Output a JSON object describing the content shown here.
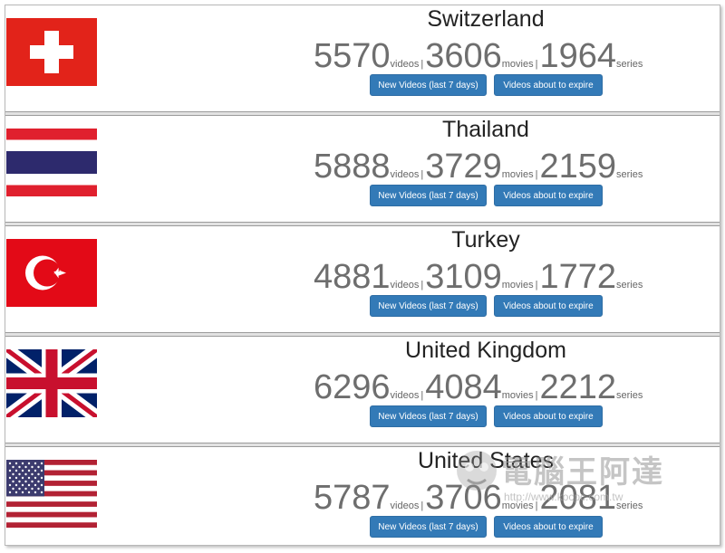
{
  "buttons": {
    "new_videos": "New Videos (last 7 days)",
    "about_to_expire": "Videos about to expire"
  },
  "units": {
    "videos": "videos",
    "movies": "movies",
    "series": "series",
    "separator": "|"
  },
  "countries": [
    {
      "name": "Switzerland",
      "flag_icon": "flag-switzerland-icon",
      "videos": "5570",
      "movies": "3606",
      "series": "1964"
    },
    {
      "name": "Thailand",
      "flag_icon": "flag-thailand-icon",
      "videos": "5888",
      "movies": "3729",
      "series": "2159"
    },
    {
      "name": "Turkey",
      "flag_icon": "flag-turkey-icon",
      "videos": "4881",
      "movies": "3109",
      "series": "1772"
    },
    {
      "name": "United Kingdom",
      "flag_icon": "flag-united-kingdom-icon",
      "videos": "6296",
      "movies": "4084",
      "series": "2212"
    },
    {
      "name": "United States",
      "flag_icon": "flag-united-states-icon",
      "videos": "5787",
      "movies": "3706",
      "series": "2081"
    }
  ],
  "watermark": {
    "text": "電腦王阿達",
    "url": "http://www.kocpc.com.tw"
  },
  "colors": {
    "button_bg": "#337ab7",
    "number_gray": "#6e6e6e"
  }
}
